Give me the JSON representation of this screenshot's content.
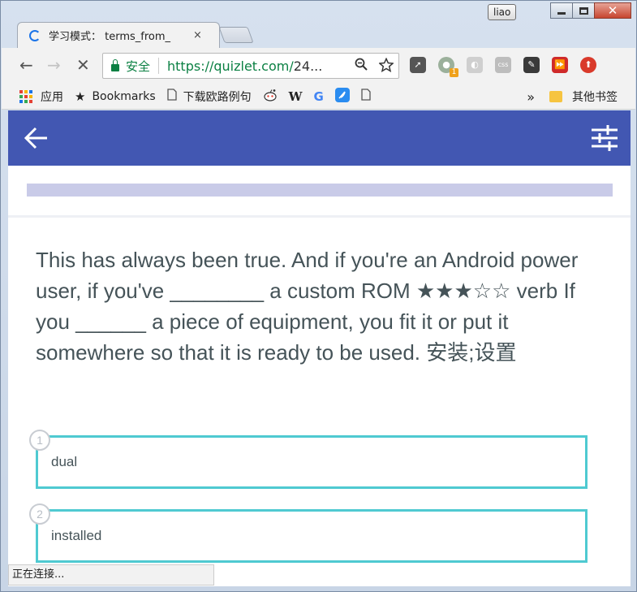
{
  "window": {
    "user": "liao"
  },
  "tab": {
    "title": "学习模式： terms_from_",
    "close": "×"
  },
  "toolbar": {
    "back": "←",
    "forward": "→",
    "stop": "✕",
    "secure_label": "安全",
    "url_scheme_host": "https://quizlet.com/",
    "url_rest": "24...",
    "extensions": [
      {
        "name": "rocket-icon",
        "color": "#555555"
      },
      {
        "name": "record-icon",
        "color": "#9bb09b",
        "badge": "1"
      },
      {
        "name": "loop-icon",
        "color": "#cfcfcf"
      },
      {
        "name": "css-icon",
        "color": "#bdbdbd"
      },
      {
        "name": "evernote-icon",
        "color": "#3a3a3a"
      },
      {
        "name": "fast-forward-icon",
        "color": "#cf2a2a"
      },
      {
        "name": "upload-icon",
        "color": "#d93a2b"
      }
    ]
  },
  "bookmarks": {
    "apps": "应用",
    "bookmarks": "Bookmarks",
    "page1": "下载欧路例句",
    "w": "W",
    "g": "G",
    "overflow": "»",
    "other": "其他书签"
  },
  "quiz": {
    "progress": 0.0,
    "prompt": "This has always been true. And if you're an Android power user, if you've ________ a custom ROM ★★★☆☆ verb If you ______ a piece of equipment, you fit it or put it somewhere so that it is ready to be used. 安装;设置",
    "options": [
      {
        "number": "1",
        "text": "dual"
      },
      {
        "number": "2",
        "text": "installed"
      }
    ]
  },
  "status": "正在连接..."
}
